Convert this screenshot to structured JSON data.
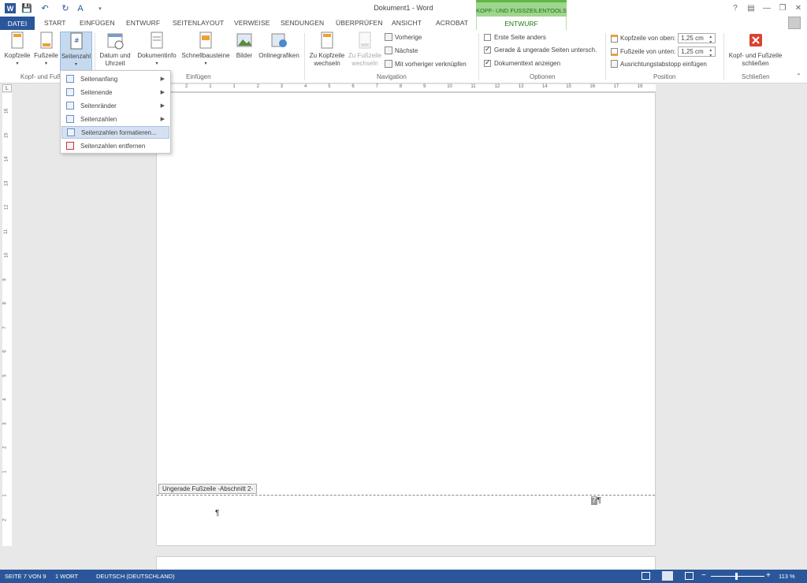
{
  "title": "Dokument1 - Word",
  "contextual_header": "KOPF- UND FUSSZEILENTOOLS",
  "tabs": [
    "DATEI",
    "START",
    "EINFÜGEN",
    "ENTWURF",
    "SEITENLAYOUT",
    "VERWEISE",
    "SENDUNGEN",
    "ÜBERPRÜFEN",
    "ANSICHT",
    "ACROBAT"
  ],
  "contextual_tab": "ENTWURF",
  "ribbon": {
    "kopfzeile": "Kopfzeile",
    "fusszeile": "Fußzeile",
    "seitenzahl": "Seitenzahl",
    "group_kopf_fuss": "Kopf- und Fuß",
    "datum": "Datum und Uhrzeit",
    "dokumentinfo": "Dokumentinfo",
    "schnellbausteine": "Schnellbausteine",
    "bilder": "Bilder",
    "onlinegrafiken": "Onlinegrafiken",
    "group_einfuegen": "Einfügen",
    "zu_kopfzeile": "Zu Kopfzeile wechseln",
    "zu_fusszeile": "Zu Fußzeile wechseln",
    "vorherige": "Vorherige",
    "naechste": "Nächste",
    "mit_vorheriger": "Mit vorheriger verknüpfen",
    "group_navigation": "Navigation",
    "erste_seite": "Erste Seite anders",
    "gerade_ungerade": "Gerade & ungerade Seiten untersch.",
    "dokumenttext": "Dokumenttext anzeigen",
    "group_optionen": "Optionen",
    "kopf_oben_label": "Kopfzeile von oben:",
    "kopf_oben_val": "1,25 cm",
    "fuss_unten_label": "Fußzeile von unten:",
    "fuss_unten_val": "1,25 cm",
    "ausrichtung": "Ausrichtungstabstopp einfügen",
    "group_position": "Position",
    "schliessen": "Kopf- und Fußzeile schließen",
    "group_schliessen": "Schließen"
  },
  "options_state": {
    "erste_seite": false,
    "gerade_ungerade": true,
    "dokumenttext": true
  },
  "menu": {
    "items": [
      {
        "label": "Seitenanfang",
        "submenu": true
      },
      {
        "label": "Seitenende",
        "submenu": true
      },
      {
        "label": "Seitenränder",
        "submenu": true
      },
      {
        "label": "Seitenzahlen",
        "submenu": true
      },
      {
        "label": "Seitenzahlen formatieren...",
        "submenu": false
      },
      {
        "label": "Seitenzahlen entfernen",
        "submenu": false
      }
    ]
  },
  "document": {
    "footer_tag": "Ungerade Fußzeile -Abschnitt 2-",
    "pilcrow": "¶",
    "page_number": "7",
    "ruler_numbers": [
      "2",
      "1",
      "1",
      "2",
      "3",
      "4",
      "5",
      "6",
      "7",
      "8",
      "9",
      "10",
      "11",
      "12",
      "13",
      "14",
      "15",
      "16",
      "17",
      "18"
    ],
    "ruler_left_numbers": [
      "16",
      "15",
      "14",
      "13",
      "12",
      "11",
      "10",
      "9",
      "8",
      "7",
      "6",
      "5",
      "4",
      "3",
      "2",
      "1",
      "1",
      "2"
    ]
  },
  "status": {
    "page": "SEITE 7 VON 9",
    "words": "1 WORT",
    "language": "DEUTSCH (DEUTSCHLAND)",
    "zoom": "113 %"
  },
  "colors": {
    "accent": "#2b579a",
    "contextual": "#5fb845"
  }
}
